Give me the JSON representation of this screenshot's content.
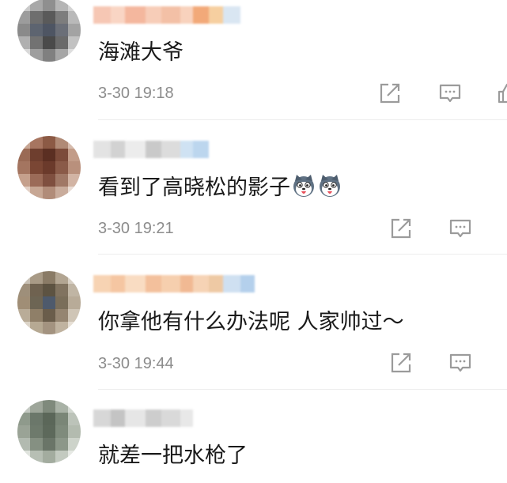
{
  "comments": [
    {
      "text": "海滩大爷",
      "time": "3-30 19:18",
      "avatar_colors": [
        "#c9c9c9",
        "#a8a8a8",
        "#8f8f8f",
        "#b5b5b5",
        "#d3d3d3",
        "#9c9c9c",
        "#6e6e6e",
        "#5a5a5a",
        "#7d7d7d",
        "#b9b9b9",
        "#8a8a8a",
        "#5d6470",
        "#4e5563",
        "#6b6f78",
        "#a3a3a3",
        "#b0b0b0",
        "#727272",
        "#4a4a4a",
        "#6a6a6a",
        "#c2c2c2",
        "#d8d8d8",
        "#9e9e9e",
        "#808080",
        "#a6a6a6",
        "#dedede"
      ],
      "name_colors": [
        "#f6c7b4",
        "#f9d5c4",
        "#f4b79e",
        "#f7cdb8",
        "#f3c0a6",
        "#f8d2bd",
        "#f2a979",
        "#f6cfa0",
        "#d9e6f2"
      ]
    },
    {
      "text": "看到了高晓松的影子",
      "time": "3-30 19:21",
      "avatar_colors": [
        "#c7a593",
        "#a77560",
        "#8c5a45",
        "#b08a76",
        "#d6bcae",
        "#9a6a55",
        "#6e3e2e",
        "#5b2f22",
        "#7c4b3a",
        "#c29c88",
        "#a47560",
        "#7a4634",
        "#6b3a2b",
        "#8a5a48",
        "#b9907c",
        "#c5a08c",
        "#9b6b58",
        "#7f4f3f",
        "#a07866",
        "#d2b4a4",
        "#e2cfc4",
        "#c7a794",
        "#b18c79",
        "#c9ac9c",
        "#e9dcd4"
      ],
      "name_colors": [
        "#e3e3e3",
        "#d2d2d2",
        "#ececec",
        "#c9c9c9",
        "#dcdcdc",
        "#cfe2f3",
        "#bcd6ee"
      ]
    },
    {
      "text": "你拿他有什么办法呢 人家帅过～",
      "time": "3-30 19:44",
      "avatar_colors": [
        "#c8c0b4",
        "#a89a86",
        "#8a7b66",
        "#b2a592",
        "#d7cfc4",
        "#9e8f7a",
        "#6f6250",
        "#5d5342",
        "#817360",
        "#c0b5a4",
        "#a08e76",
        "#6d6554",
        "#4e5a6c",
        "#7a6e5a",
        "#b8ab98",
        "#b9ac98",
        "#8f7f68",
        "#6a5d4b",
        "#958571",
        "#cfc5b6",
        "#dcd4c8",
        "#b6a993",
        "#a39380",
        "#c0b3a0",
        "#e6dfd5"
      ],
      "name_colors": [
        "#f7d3b3",
        "#f5c6a2",
        "#f9dcc2",
        "#f3c09c",
        "#f6cfae",
        "#f1b993",
        "#f6d3b5",
        "#eec9a4",
        "#cfe0f1",
        "#b4d0ec"
      ]
    },
    {
      "text": "就差一把水枪了",
      "time": "",
      "avatar_colors": [
        "#c4c9c2",
        "#9ea69a",
        "#7f8a7c",
        "#a9b2a6",
        "#d3d8d1",
        "#8f9a8c",
        "#6b776a",
        "#5b6759",
        "#7a8677",
        "#bcc3b9",
        "#9aa396",
        "#6e7a6c",
        "#5d695b",
        "#7f8b7c",
        "#b3bbaf",
        "#b2bab0",
        "#859082",
        "#6a7568",
        "#8c9789",
        "#cdd3ca",
        "#dfe3dd",
        "#b7bfb4",
        "#a3ac9f",
        "#c3cac0",
        "#e6e9e4"
      ],
      "name_colors": [
        "#d7d7d7",
        "#c4c4c4",
        "#e6e6e6",
        "#cdcdcd",
        "#d9d9d9",
        "#e8e8e8"
      ]
    }
  ],
  "icons": {
    "share": "share-icon",
    "comment": "comment-icon",
    "like": "like-icon",
    "emoji": "dog-face-emoji"
  },
  "colors": {
    "text": "#1a1a1a",
    "time": "#8c8c8c",
    "icon": "#9b9b9b",
    "divider": "#ededed"
  }
}
